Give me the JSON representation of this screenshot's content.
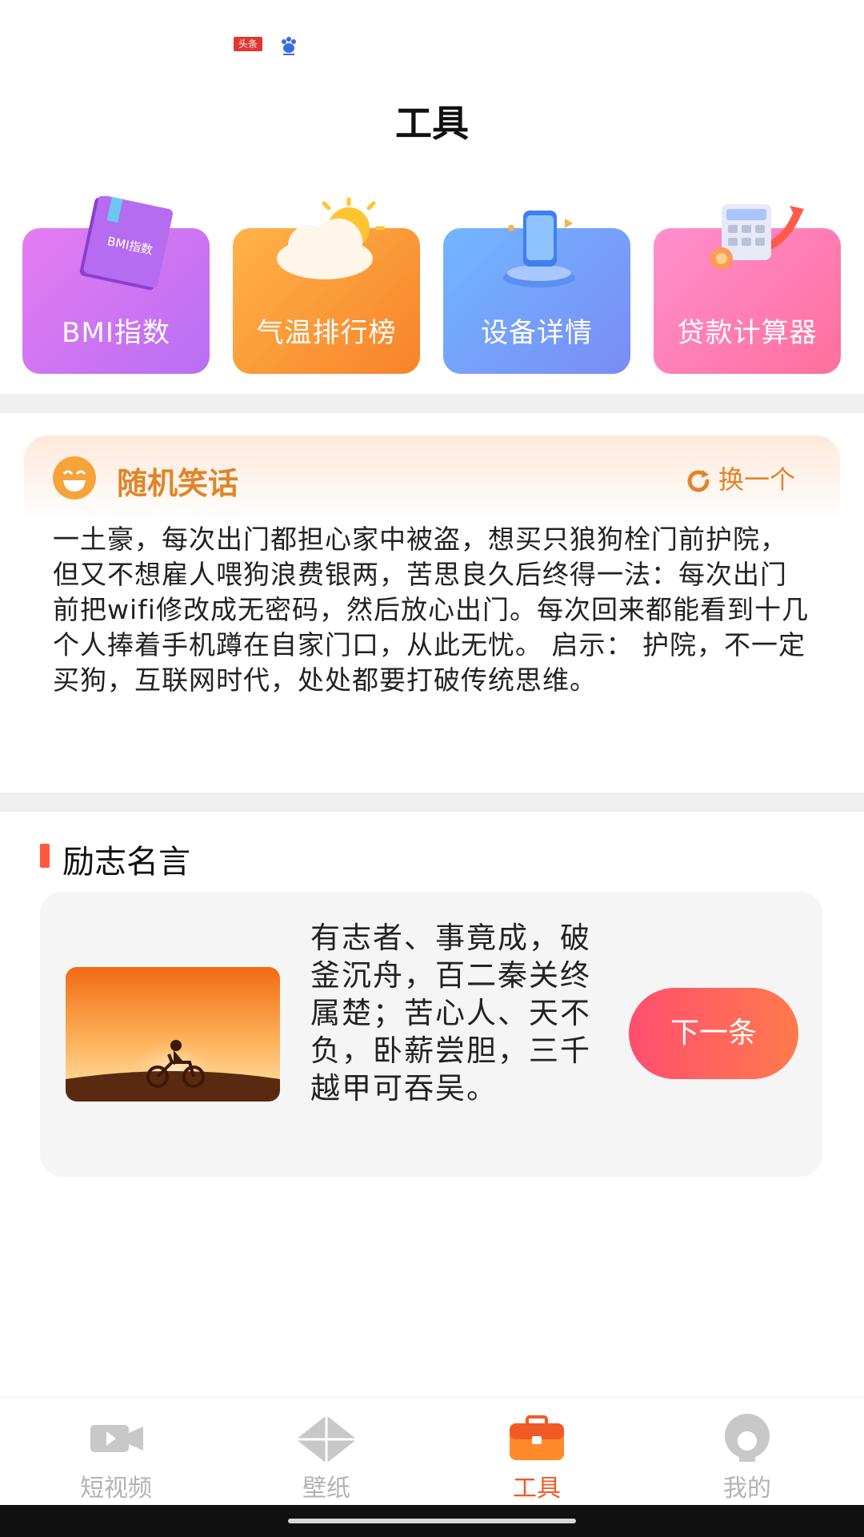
{
  "status_bar": {
    "badge_text": "头条"
  },
  "page": {
    "title": "工具"
  },
  "tools": [
    {
      "label": "BMI指数",
      "book_text": "BMI指数",
      "color": "#c979f2"
    },
    {
      "label": "气温排行榜",
      "color": "#f7962f"
    },
    {
      "label": "设备详情",
      "color": "#7aa2f8"
    },
    {
      "label": "贷款计算器",
      "color": "#ff7fb3"
    }
  ],
  "joke": {
    "title": "随机笑话",
    "refresh_label": "换一个",
    "text": "一土豪，每次出门都担心家中被盗，想买只狼狗栓门前护院，但又不想雇人喂狗浪费银两，苦思良久后终得一法：每次出门前把wifi修改成无密码，然后放心出门。每次回来都能看到十几个人捧着手机蹲在自家门口，从此无忧。 启示： 护院，不一定买狗，互联网时代，处处都要打破传统思维。"
  },
  "motto": {
    "section_title": "励志名言",
    "quote": "有志者、事竟成，破釜沉舟，百二秦关终属楚；苦心人、天不负，卧薪尝胆，三千越甲可吞吴。",
    "next_label": "下一条"
  },
  "nav": {
    "items": [
      {
        "label": "短视频",
        "icon": "video-camera-icon",
        "active": false
      },
      {
        "label": "壁纸",
        "icon": "wallpaper-icon",
        "active": false
      },
      {
        "label": "工具",
        "icon": "toolbox-icon",
        "active": true
      },
      {
        "label": "我的",
        "icon": "profile-icon",
        "active": false
      }
    ],
    "active_color": "#f15a24"
  }
}
